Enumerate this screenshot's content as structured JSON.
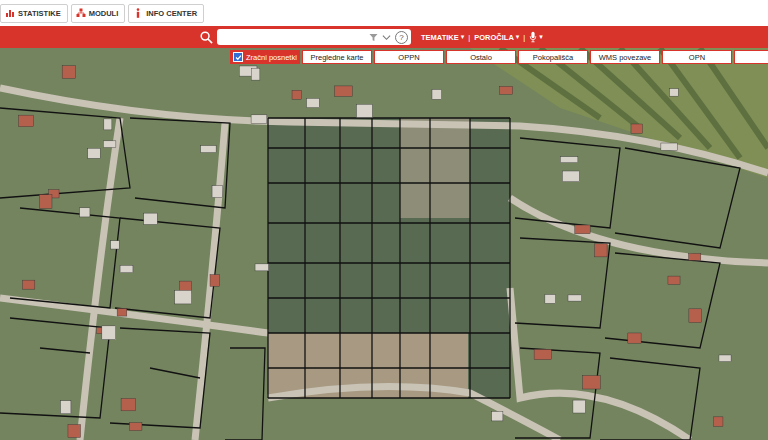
{
  "header": {
    "buttons": [
      {
        "label": "STATISTIKE",
        "icon": "chart"
      },
      {
        "label": "MODULI",
        "icon": "modules"
      },
      {
        "label": "INFO CENTER",
        "icon": "info"
      }
    ]
  },
  "toolbar": {
    "search": {
      "help": "?"
    },
    "menus": [
      {
        "label": "TEMATIKE",
        "arrow": "▾"
      },
      {
        "label": "POROČILA",
        "arrow": "▾"
      }
    ],
    "separator": "|",
    "voice_arrow": "▾"
  },
  "layer_tabs": [
    {
      "label": "Zračni posnetki",
      "selected": true,
      "checked": true
    },
    {
      "label": "Pregledne karte",
      "selected": false,
      "checked": false
    },
    {
      "label": "OPPN",
      "selected": false,
      "checked": false
    },
    {
      "label": "Ostalo",
      "selected": false,
      "checked": false
    },
    {
      "label": "Pokopališča",
      "selected": false,
      "checked": false
    },
    {
      "label": "WMS povezave",
      "selected": false,
      "checked": false
    },
    {
      "label": "OPN",
      "selected": false,
      "checked": false
    }
  ]
}
